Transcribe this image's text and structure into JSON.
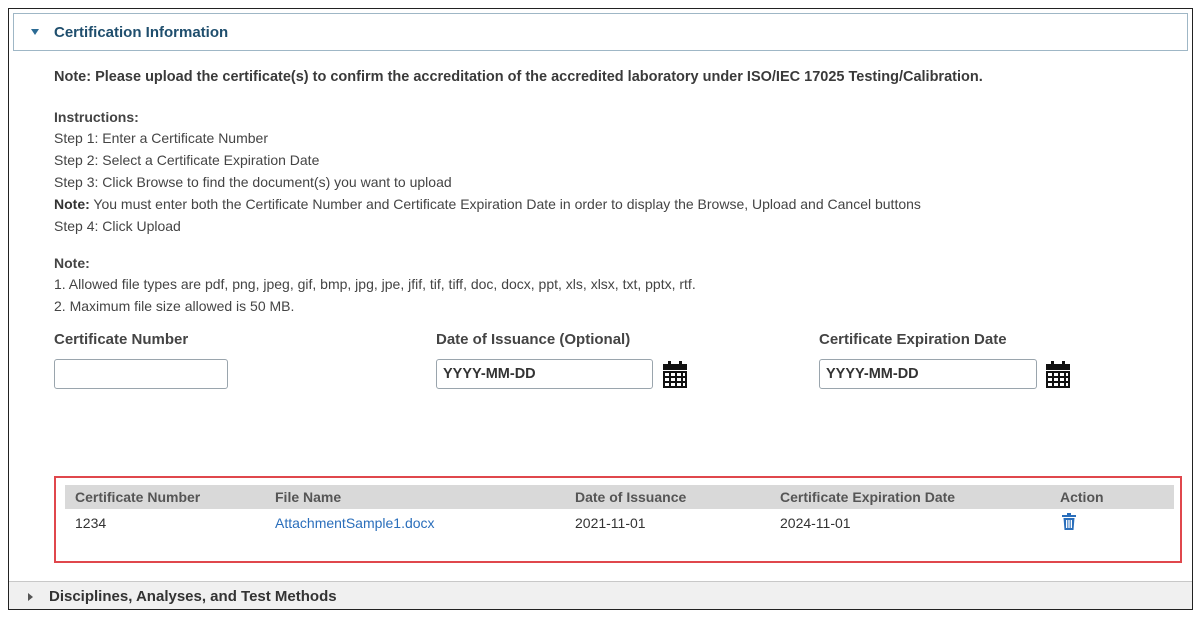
{
  "section1": {
    "title": "Certification Information",
    "note_main": "Note: Please upload the certificate(s) to confirm the accreditation of the accredited laboratory under ISO/IEC 17025 Testing/Calibration.",
    "instructions_title": "Instructions:",
    "steps": [
      "Step 1: Enter a Certificate Number",
      "Step 2: Select a Certificate Expiration Date",
      "Step 3: Click Browse to find the document(s) you want to upload"
    ],
    "inline_note_label": "Note:",
    "inline_note_text": " You must enter both the Certificate Number and Certificate Expiration Date in order to display the Browse, Upload and Cancel buttons",
    "step4": "Step 4: Click Upload",
    "note_title": "Note:",
    "notes": [
      "1. Allowed file types are pdf, png, jpeg, gif, bmp, jpg, jpe, jfif, tif, tiff, doc, docx, ppt, xls, xlsx, txt, pptx, rtf.",
      "2. Maximum file size allowed is 50 MB."
    ]
  },
  "form": {
    "cert_number_label": "Certificate Number",
    "cert_number_value": "",
    "issuance_label": "Date of Issuance (Optional)",
    "issuance_value": "YYYY-MM-DD",
    "expiration_label": "Certificate Expiration Date",
    "expiration_value": "YYYY-MM-DD"
  },
  "table": {
    "headers": {
      "cert_number": "Certificate Number",
      "file_name": "File Name",
      "issuance": "Date of Issuance",
      "expiration": "Certificate Expiration Date",
      "action": "Action"
    },
    "rows": [
      {
        "cert_number": "1234",
        "file_name": "AttachmentSample1.docx",
        "issuance": "2021-11-01",
        "expiration": "2024-11-01",
        "action_icon": "trash-icon"
      }
    ]
  },
  "section2": {
    "title": "Disciplines, Analyses, and Test Methods"
  },
  "colors": {
    "header_title": "#1f4e6d",
    "link": "#2a6ebb",
    "highlight_border": "#e0474c",
    "table_header_bg": "#d9d9d9"
  }
}
